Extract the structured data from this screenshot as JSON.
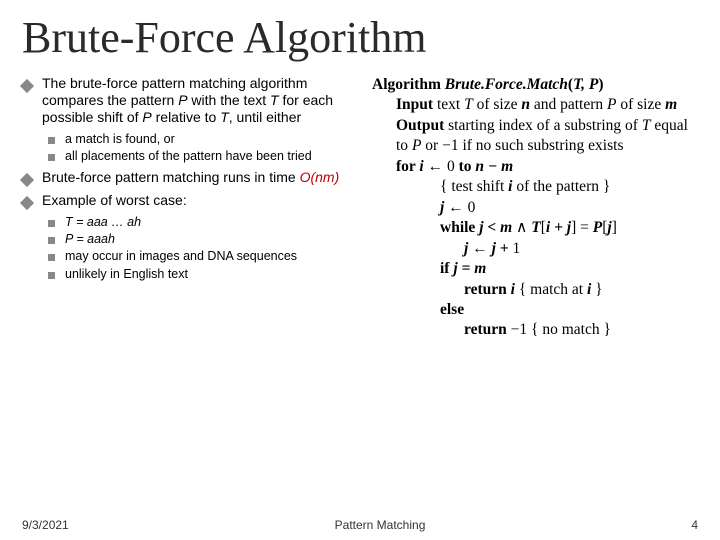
{
  "title": "Brute-Force Algorithm",
  "left": {
    "item1_a": "The brute-force pattern matching algorithm compares the pattern ",
    "item1_P": "P",
    "item1_b": " with the text ",
    "item1_T": "T",
    "item1_c": " for each possible shift of ",
    "item1_P2": "P",
    "item1_d": " relative to ",
    "item1_T2": "T",
    "item1_e": ", until either",
    "sub1a": "a match is found, or",
    "sub1b": "all placements of the pattern have been tried",
    "item2_a": "Brute-force pattern matching runs in time ",
    "item2_onm": "O(nm)",
    "item3": "Example of worst case:",
    "sub3a_a": "T = aaa … ah",
    "sub3b_a": "P = aaah",
    "sub3c": "may occur in images and DNA sequences",
    "sub3d": "unlikely in English text"
  },
  "algo": {
    "l1a": "Algorithm ",
    "l1b": "Brute.​Force.​Match",
    "l1c": "(",
    "l1d": "T, P",
    "l1e": ")",
    "l2a": "Input",
    "l2b": " text ",
    "l2c": "T",
    "l2d": " of size ",
    "l2e": "n",
    "l2f": " and pattern ",
    "l2g": "P",
    "l2h": " of size ",
    "l2i": "m",
    "l3a": "Output",
    "l3b": " starting index of a substring of ",
    "l3c": "T",
    "l3d": " equal to ",
    "l3e": "P",
    "l3f": " or ",
    "l3g": "−",
    "l3h": "1 if no such substring exists",
    "l4a": "for  ",
    "l4b": "i",
    "l4c": " ← 0 ",
    "l4d": "to",
    "l4e": " ",
    "l4f": "n − m",
    "l5a": "{ test shift ",
    "l5b": "i",
    "l5c": " of the pattern }",
    "l6a": "j",
    "l6b": " ← 0",
    "l7a": "while ",
    "l7b": "j < m",
    "l7c": " ∧ ",
    "l7d": "T",
    "l7e": "[",
    "l7f": "i + j",
    "l7g": "] = ",
    "l7h": "P",
    "l7i": "[",
    "l7j": "j",
    "l7k": "]",
    "l8a": "j",
    "l8b": " ← ",
    "l8c": "j + ",
    "l8d": "1",
    "l9a": "if ",
    "l9b": "j = m",
    "l10a": "return  ",
    "l10b": "i",
    "l10c": " { match at ",
    "l10d": "i",
    "l10e": " }",
    "l11a": "else",
    "l12a": "return  ",
    "l12b": "−",
    "l12c": "1 { no match }"
  },
  "footer": {
    "date": "9/3/2021",
    "center": "Pattern Matching",
    "page": "4"
  }
}
